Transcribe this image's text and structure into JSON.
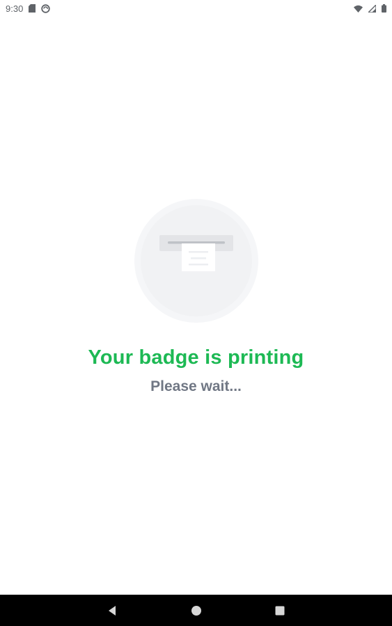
{
  "status_bar": {
    "time": "9:30",
    "icons_left": [
      "sd-card-icon",
      "sync-icon"
    ],
    "icons_right": [
      "wifi-icon",
      "signal-icon",
      "battery-icon"
    ]
  },
  "main": {
    "illustration": "printer-icon",
    "title": "Your badge is printing",
    "subtitle": "Please wait..."
  },
  "nav_bar": {
    "buttons": [
      "back",
      "home",
      "recents"
    ]
  },
  "colors": {
    "title": "#1db954",
    "subtitle": "#707784",
    "nav_background": "#000000",
    "illustration_circle": "#f2f3f5"
  }
}
